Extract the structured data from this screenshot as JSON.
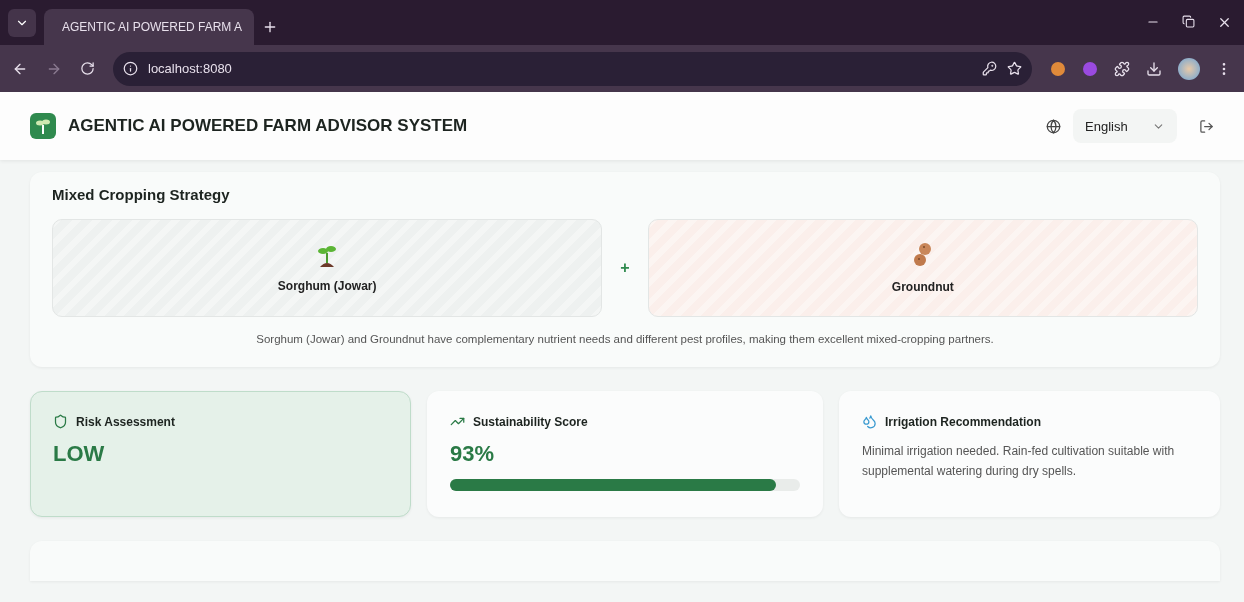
{
  "browser": {
    "tab_title": "AGENTIC AI POWERED FARM A",
    "url": "localhost:8080"
  },
  "header": {
    "title": "AGENTIC AI POWERED FARM ADVISOR SYSTEM",
    "language": "English"
  },
  "mixed_cropping": {
    "title": "Mixed Cropping Strategy",
    "separator": "+",
    "crops": [
      {
        "name": "Sorghum (Jowar)",
        "kind": "sprout",
        "color": "#eef1f0"
      },
      {
        "name": "Groundnut",
        "kind": "peanut",
        "color": "#fbefeb"
      }
    ],
    "description": "Sorghum (Jowar) and Groundnut have complementary nutrient needs and different pest profiles, making them excellent mixed-cropping partners."
  },
  "stats": [
    {
      "kind": "risk",
      "title": "Risk Assessment",
      "value": "LOW"
    },
    {
      "kind": "score",
      "title": "Sustainability Score",
      "value": "93%",
      "level": 0.93
    },
    {
      "kind": "irrigation",
      "title": "Irrigation Recommendation",
      "text": "Minimal irrigation needed. Rain-fed cultivation suitable with supplemental watering during dry spells."
    }
  ]
}
